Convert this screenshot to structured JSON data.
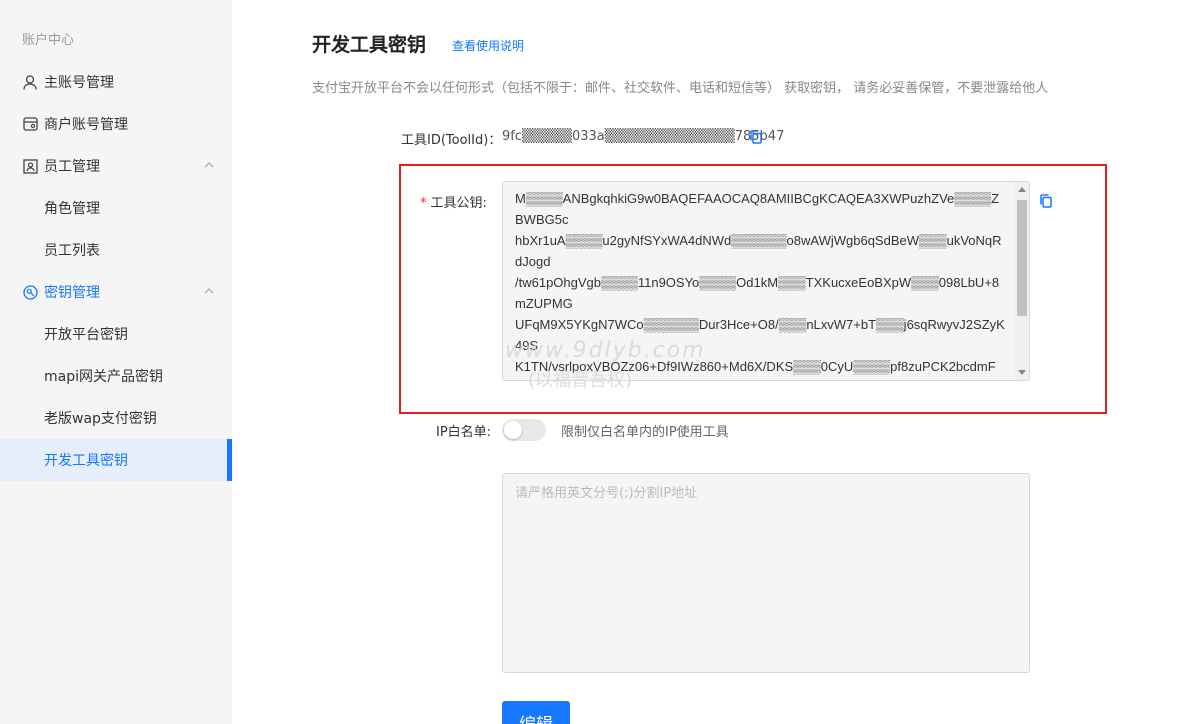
{
  "sidebar": {
    "heading": "账户中心",
    "items": [
      {
        "label": "主账号管理",
        "icon": "user-icon"
      },
      {
        "label": "商户账号管理",
        "icon": "store-icon"
      },
      {
        "label": "员工管理",
        "icon": "staff-icon",
        "expanded": true
      },
      {
        "label": "角色管理"
      },
      {
        "label": "员工列表"
      },
      {
        "label": "密钥管理",
        "icon": "key-icon",
        "expanded": true
      },
      {
        "label": "开放平台密钥"
      },
      {
        "label": "mapi网关产品密钥"
      },
      {
        "label": "老版wap支付密钥"
      },
      {
        "label": "开发工具密钥",
        "active": true
      }
    ]
  },
  "main": {
    "title": "开发工具密钥",
    "help_link": "查看使用说明",
    "description": "支付宝开放平台不会以任何形式（包括不限于：邮件、社交软件、电话和短信等） 获取密钥， 请务必妥善保管，不要泄露给他人",
    "toolid_label": "工具ID(ToolId)：",
    "toolid_value": "9fc▒▒▒▒▒033a▒▒▒▒▒▒▒▒▒▒▒▒▒785b47",
    "pubkey_label": "工具公钥:",
    "pubkey_lines": "M▒▒▒▒ANBgkqhkiG9w0BAQEFAAOCAQ8AMIIBCgKCAQEA3XWPuzhZVe▒▒▒▒ZBWBG5c\nhbXr1uA▒▒▒▒u2gyNfSYxWA4dNWd▒▒▒▒▒▒o8wAWjWgb6qSdBeW▒▒▒ukVoNqRdJogd\n/tw61pOhgVgb▒▒▒▒11n9OSYo▒▒▒▒Od1kM▒▒▒TXKucxeEoBXpW▒▒▒098LbU+8mZUPMG\nUFqM9X5YKgN7WCo▒▒▒▒▒▒Dur3Hce+O8/▒▒▒nLxvW7+bT▒▒▒j6sqRwyvJ2SZyK49S\nK1TN/vsrlpoxVBOZz06+Df9IWz860+Md6X/DKS▒▒▒0CyU▒▒▒▒pf8zuPCK2bcdmF",
    "watermark1": "www.9dlyb.com",
    "watermark2": "(以福音吾权)",
    "ip_label": "IP白名单:",
    "ip_toggle_hint": "限制仅白名单内的IP使用工具",
    "ip_placeholder": "请严格用英文分号(;)分割IP地址",
    "edit_button": "编辑"
  },
  "colors": {
    "accent": "#1677ff",
    "highlight_border": "#e02020",
    "required": "#f5222d"
  }
}
